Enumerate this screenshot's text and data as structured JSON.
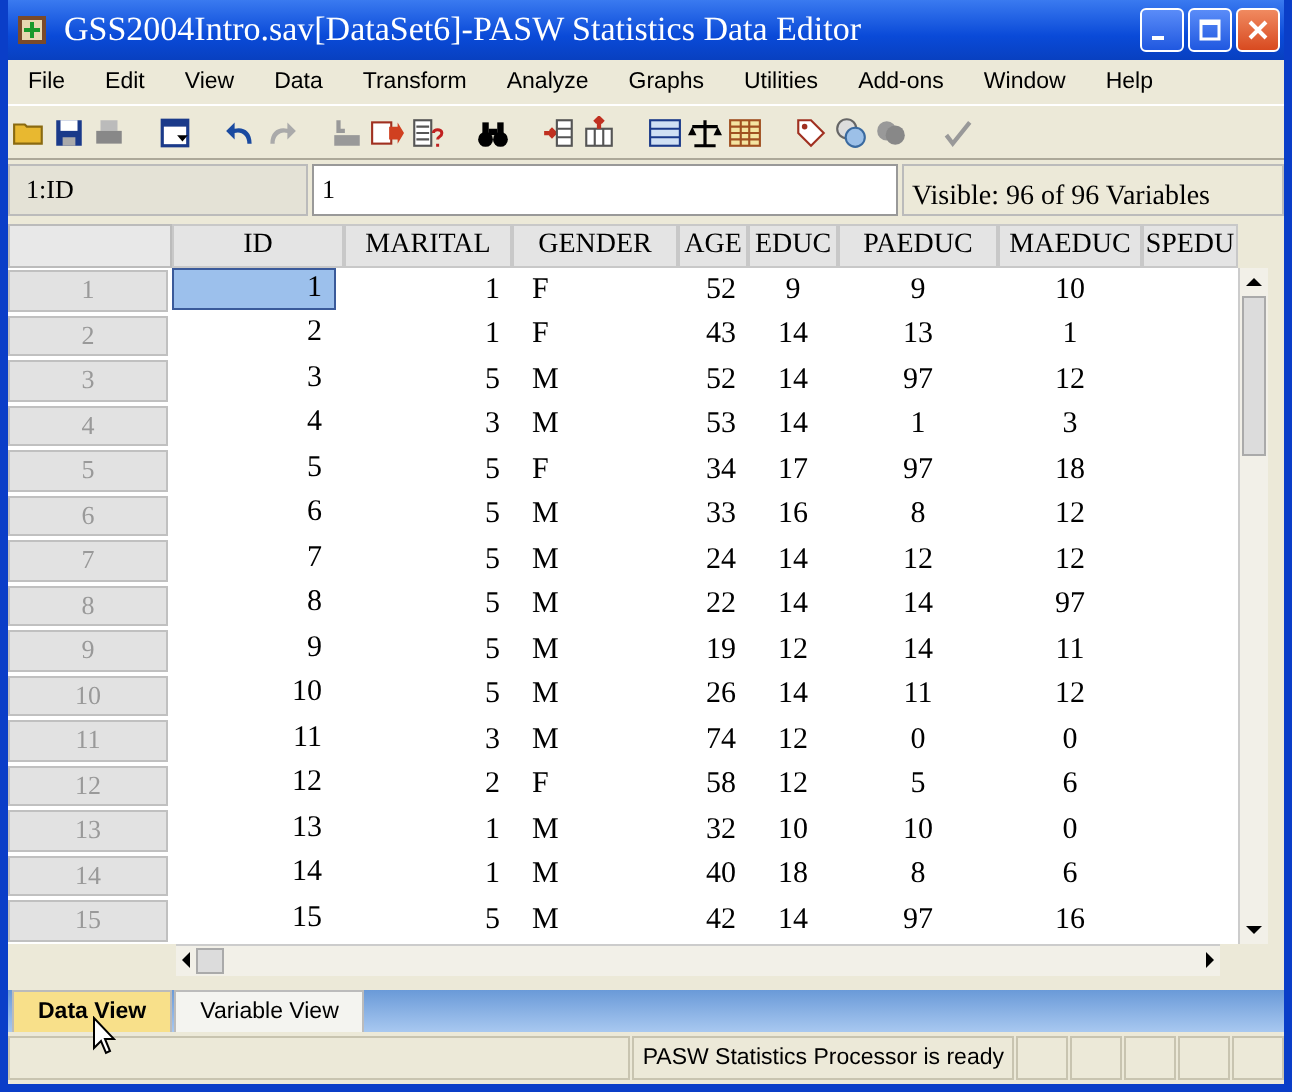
{
  "window": {
    "title": "GSS2004Intro.sav[DataSet6]-PASW Statistics Data Editor"
  },
  "menu": [
    "File",
    "Edit",
    "View",
    "Data",
    "Transform",
    "Analyze",
    "Graphs",
    "Utilities",
    "Add-ons",
    "Window",
    "Help"
  ],
  "cell_editor": {
    "cell_ref": "1:ID",
    "value": "1",
    "visible_info": "Visible: 96 of 96 Variables"
  },
  "table": {
    "columns": [
      {
        "label": "ID"
      },
      {
        "label": "MARITAL"
      },
      {
        "label": "GENDER"
      },
      {
        "label": "AGE"
      },
      {
        "label": "EDUC"
      },
      {
        "label": "PAEDUC"
      },
      {
        "label": "MAEDUC"
      },
      {
        "label": "SPEDU"
      }
    ],
    "rows": [
      {
        "number": "1",
        "selected": true,
        "cells": [
          "1",
          "1",
          "F",
          "52",
          "9",
          "9",
          "10"
        ]
      },
      {
        "number": "2",
        "selected": false,
        "cells": [
          "2",
          "1",
          "F",
          "43",
          "14",
          "13",
          "1"
        ]
      },
      {
        "number": "3",
        "selected": false,
        "cells": [
          "3",
          "5",
          "M",
          "52",
          "14",
          "97",
          "12"
        ]
      },
      {
        "number": "4",
        "selected": false,
        "cells": [
          "4",
          "3",
          "M",
          "53",
          "14",
          "1",
          "3"
        ]
      },
      {
        "number": "5",
        "selected": false,
        "cells": [
          "5",
          "5",
          "F",
          "34",
          "17",
          "97",
          "18"
        ]
      },
      {
        "number": "6",
        "selected": false,
        "cells": [
          "6",
          "5",
          "M",
          "33",
          "16",
          "8",
          "12"
        ]
      },
      {
        "number": "7",
        "selected": false,
        "cells": [
          "7",
          "5",
          "M",
          "24",
          "14",
          "12",
          "12"
        ]
      },
      {
        "number": "8",
        "selected": false,
        "cells": [
          "8",
          "5",
          "M",
          "22",
          "14",
          "14",
          "97"
        ]
      },
      {
        "number": "9",
        "selected": false,
        "cells": [
          "9",
          "5",
          "M",
          "19",
          "12",
          "14",
          "11"
        ]
      },
      {
        "number": "10",
        "selected": false,
        "cells": [
          "10",
          "5",
          "M",
          "26",
          "14",
          "11",
          "12"
        ]
      },
      {
        "number": "11",
        "selected": false,
        "cells": [
          "11",
          "3",
          "M",
          "74",
          "12",
          "0",
          "0"
        ]
      },
      {
        "number": "12",
        "selected": false,
        "cells": [
          "12",
          "2",
          "F",
          "58",
          "12",
          "5",
          "6"
        ]
      },
      {
        "number": "13",
        "selected": false,
        "cells": [
          "13",
          "1",
          "M",
          "32",
          "10",
          "10",
          "0"
        ]
      },
      {
        "number": "14",
        "selected": false,
        "cells": [
          "14",
          "1",
          "M",
          "40",
          "18",
          "8",
          "6"
        ]
      },
      {
        "number": "15",
        "selected": false,
        "cells": [
          "15",
          "5",
          "M",
          "42",
          "14",
          "97",
          "16"
        ]
      }
    ]
  },
  "tabs": [
    {
      "label": "Data View",
      "selected": true
    },
    {
      "label": "Variable View",
      "selected": false
    }
  ],
  "status_bar": {
    "message": "PASW Statistics  Processor is ready"
  }
}
